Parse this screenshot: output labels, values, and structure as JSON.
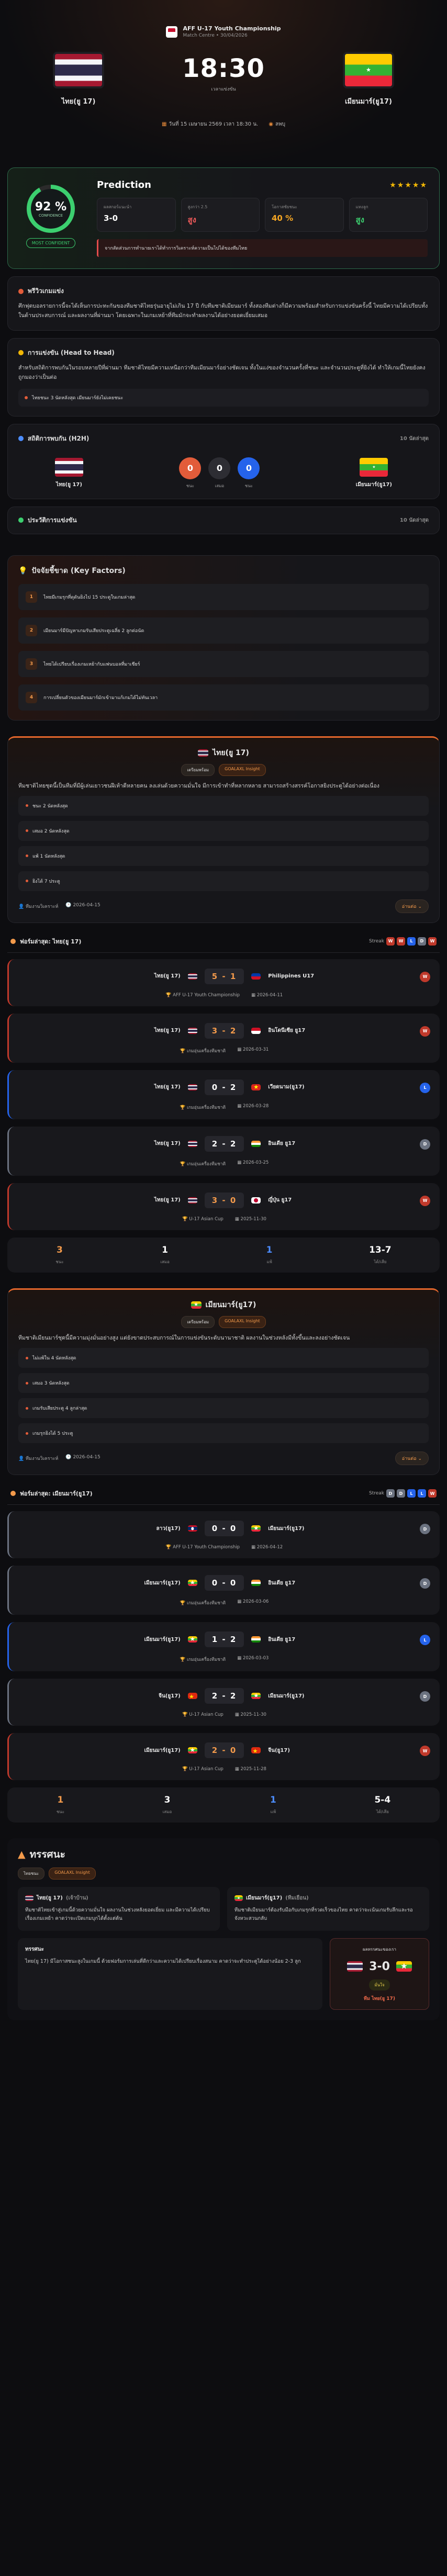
{
  "match": {
    "tournament": "AFF U-17 Youth Championship",
    "stage": "Match Centre • 30/04/2026",
    "home": "ไทย(ยู 17)",
    "away": "เมียนมาร์(ยู17)",
    "time": "18:30",
    "status": "เวลาแข่งขัน",
    "date": "วันที่ 15 เมษายน 2569 เวลา 18:30 น.",
    "venue": "ลพบุ"
  },
  "prediction": {
    "title": "Prediction",
    "confidence": "92 %",
    "confidence_label": "CONFIDENCE",
    "badge": "MOST CONFIDENT",
    "stats": [
      {
        "k": "ผลสกอร์แนะนำ",
        "v": "3-0",
        "c": ""
      },
      {
        "k": "สูงกว่า 2.5",
        "v": "สูง",
        "c": "red"
      },
      {
        "k": "โอกาสชัยชนะ",
        "v": "40 %",
        "c": "org"
      },
      {
        "k": "แทงลูก",
        "v": "สูง",
        "c": "grn"
      }
    ],
    "note": "จากสัดส่วนการทำนายเราได้ทำการวิเคราะห์ความเป็นไปได้ของทีมไทย"
  },
  "preview": {
    "title": "พรีวิวเกมแข่ง",
    "text": "ศึกฟุตบอลรายการนี้จะได้เห็นการปะทะกันของทีมชาติไทยรุ่นอายุไม่เกิน 17 ปี กับทีมชาติเมียนมาร์ ทั้งสองทีมต่างก็มีความพร้อมสำหรับการแข่งขันครั้งนี้ ไทยมีความได้เปรียบทั้งในด้านประสบการณ์ และผลงานที่ผ่านมา โดยเฉพาะในเกมเหย้าที่ทีมมักจะทำผลงานได้อย่างยอดเยี่ยมเสมอ"
  },
  "h2h": {
    "title": "การแข่งขัน (Head to Head)",
    "text": "สำหรับสถิติการพบกันในรอบหลายปีที่ผ่านมา ทีมชาติไทยมีความเหนือกว่าทีมเมียนมาร์อย่างชัดเจน ทั้งในแง่ของจำนวนครั้งที่ชนะ และจำนวนประตูที่ยิงได้ ทำให้เกมนี้ไทยยังคงถูกมองว่าเป็นต่อ",
    "pill": "ไทยชนะ 3 นัดหลังสุด เมียนมาร์ยังไม่เคยชนะ"
  },
  "h2h_stats": {
    "title": "สถิติการพบกัน (H2H)",
    "right": "10 นัดล่าสุด",
    "home_win": "0",
    "draw": "0",
    "away_win": "0",
    "home_label": "ชนะ",
    "draw_label": "เสมอ",
    "away_label": "ชนะ"
  },
  "form_title": {
    "title": "ประวัติการแข่งขัน",
    "right": "10 นัดล่าสุด"
  },
  "key_factors": {
    "title": "ปัจจัยชี้ขาด (Key Factors)",
    "items": [
      "ไทยมีเกมรุกที่ดุดันยิงไป 15 ประตูในเกมล่าสุด",
      "เมียนมาร์มีปัญหาเกมรับเสียประตูเฉลี่ย 2 ลูกต่อนัด",
      "ไทยได้เปรียบเรื่องเกมเหย้ากับแฟนบอลที่มาเชียร์",
      "การเปลี่ยนตัวของเมียนมาร์มักเข้ามาแก้เกมได้ไม่ทันเวลา"
    ]
  },
  "insight_home": {
    "team": "ไทย(ยู 17)",
    "tag1": "เตรียมพร้อม",
    "tag2": "GOALAXL Insight",
    "text": "ทีมชาติไทยชุดนี้เป็นทีมที่มีผู้เล่นเยาวชนฝีเท้าดีหลายคน ลงเล่นด้วยความมั่นใจ มีการเข้าทำที่หลากหลาย สามารถสร้างสรรค์โอกาสยิงประตูได้อย่างต่อเนื่อง",
    "bullets": [
      "ชนะ 2 นัดหลังสุด",
      "เสมอ 2 นัดหลังสุด",
      "แพ้ 1 นัดหลังสุด",
      "ยิงได้ 7 ประตู"
    ],
    "author": "ทีมงานวิเคราะห์",
    "date": "2026-04-15",
    "more": "อ่านต่อ"
  },
  "form_home": {
    "title": "ฟอร์มล่าสุด: ไทย(ยู 17)",
    "streak_label": "Streak",
    "streak": [
      "W",
      "W",
      "L",
      "D",
      "W"
    ],
    "matches": [
      {
        "home": "ไทย(ยู 17)",
        "away": "Philippines U17",
        "score": "5 - 1",
        "res": "W",
        "comp": "AFF U-17 Youth Championship",
        "date": "2026-04-11",
        "hf": "flag-th",
        "af": "flag-ph"
      },
      {
        "home": "ไทย(ยู 17)",
        "away": "อินโดนีเซีย ยู17",
        "score": "3 - 2",
        "res": "W",
        "comp": "เกมอุ่นเครื่องทีมชาติ",
        "date": "2026-03-31",
        "hf": "flag-th",
        "af": "flag-id"
      },
      {
        "home": "ไทย(ยู 17)",
        "away": "เวียดนาม(ยู17)",
        "score": "0 - 2",
        "res": "L",
        "comp": "เกมอุ่นเครื่องทีมชาติ",
        "date": "2026-03-28",
        "hf": "flag-th",
        "af": "flag-vn"
      },
      {
        "home": "ไทย(ยู 17)",
        "away": "อินเดีย ยู17",
        "score": "2 - 2",
        "res": "D",
        "comp": "เกมอุ่นเครื่องทีมชาติ",
        "date": "2026-03-25",
        "hf": "flag-th",
        "af": "flag-in"
      },
      {
        "home": "ไทย(ยู 17)",
        "away": "ญี่ปุ่น ยู17",
        "score": "3 - 0",
        "res": "W",
        "comp": "U-17 Asian Cup",
        "date": "2025-11-30",
        "hf": "flag-th",
        "af": "flag-jp"
      }
    ],
    "summary": [
      {
        "v": "3",
        "k": "ชนะ",
        "c": "#f39a4b"
      },
      {
        "v": "1",
        "k": "เสมอ",
        "c": "#ffffff"
      },
      {
        "v": "1",
        "k": "แพ้",
        "c": "#4c8dff"
      },
      {
        "v": "13-7",
        "k": "ได้/เสีย",
        "c": "#ffffff"
      }
    ]
  },
  "insight_away": {
    "team": "เมียนมาร์(ยู17)",
    "tag1": "เตรียมพร้อม",
    "tag2": "GOALAXL Insight",
    "text": "ทีมชาติเมียนมาร์ชุดนี้มีความมุ่งมั่นอย่างสูง แต่ยังขาดประสบการณ์ในการแข่งขันระดับนานาชาติ ผลงานในช่วงหลังมีทั้งขึ้นและลงอย่างชัดเจน",
    "bullets": [
      "ไม่แพ้ใน 4 นัดหลังสุด",
      "เสมอ 3 นัดหลังสุด",
      "เกมรับเสียประตู 4 ลูกล่าสุด",
      "เกมรุกยิงได้ 5 ประตู"
    ],
    "author": "ทีมงานวิเคราะห์",
    "date": "2026-04-15",
    "more": "อ่านต่อ"
  },
  "form_away": {
    "title": "ฟอร์มล่าสุด: เมียนมาร์(ยู17)",
    "streak_label": "Streak",
    "streak": [
      "D",
      "D",
      "L",
      "L",
      "W"
    ],
    "matches": [
      {
        "home": "ลาว(ยู17)",
        "away": "เมียนมาร์(ยู17)",
        "score": "0 - 0",
        "res": "D",
        "comp": "AFF U-17 Youth Championship",
        "date": "2026-04-12",
        "hf": "flag-la",
        "af": "flag-mm"
      },
      {
        "home": "เมียนมาร์(ยู17)",
        "away": "อินเดีย ยู17",
        "score": "0 - 0",
        "res": "D",
        "comp": "เกมอุ่นเครื่องทีมชาติ",
        "date": "2026-03-06",
        "hf": "flag-mm",
        "af": "flag-in"
      },
      {
        "home": "เมียนมาร์(ยู17)",
        "away": "อินเดีย ยู17",
        "score": "1 - 2",
        "res": "L",
        "comp": "เกมอุ่นเครื่องทีมชาติ",
        "date": "2026-03-03",
        "hf": "flag-mm",
        "af": "flag-in"
      },
      {
        "home": "จีน(ยู17)",
        "away": "เมียนมาร์(ยู17)",
        "score": "2 - 2",
        "res": "D",
        "comp": "U-17 Asian Cup",
        "date": "2025-11-30",
        "hf": "flag-cn",
        "af": "flag-mm"
      },
      {
        "home": "เมียนมาร์(ยู17)",
        "away": "จีน(ยู17)",
        "score": "2 - 0",
        "res": "W",
        "comp": "U-17 Asian Cup",
        "date": "2025-11-28",
        "hf": "flag-mm",
        "af": "flag-cn"
      }
    ],
    "summary": [
      {
        "v": "1",
        "k": "ชนะ",
        "c": "#f39a4b"
      },
      {
        "v": "3",
        "k": "เสมอ",
        "c": "#ffffff"
      },
      {
        "v": "1",
        "k": "แพ้",
        "c": "#4c8dff"
      },
      {
        "v": "5-4",
        "k": "ได้/เสีย",
        "c": "#ffffff"
      }
    ]
  },
  "analysis": {
    "title": "ทรรศนะ",
    "tag1": "ไทยชนะ",
    "tag2": "GOALAXL Insight",
    "home_title": "ไทย(ยู 17)",
    "home_sub": "(เจ้าบ้าน)",
    "home_text": "ทีมชาติไทยเข้าสู่เกมนี้ด้วยความมั่นใจ ผลงานในช่วงหลังยอดเยี่ยม และมีความได้เปรียบเรื่องเกมเหย้า คาดว่าจะเปิดเกมบุกได้ตั้งแต่ต้น",
    "away_title": "เมียนมาร์(ยู17)",
    "away_sub": "(ทีมเยือน)",
    "away_text": "ทีมชาติเมียนมาร์ต้องรับมือกับเกมรุกที่รวดเร็วของไทย คาดว่าจะเน้นเกมรับลึกและรอจังหวะสวนกลับ",
    "final_title": "ทรรศนะ",
    "final_text": "ไทย(ยู 17) มีโอกาสชนะสูงในเกมนี้ ด้วยฟอร์มการเล่นที่ดีกว่าและความได้เปรียบเรื่องสนาม คาดว่าจะทำประตูได้อย่างน้อย 2-3 ลูก",
    "box_label": "ผลทรรศนะของเรา",
    "box_score": "3-0",
    "box_pill": "มั่นใจ",
    "box_win": "ทีม ไทย(ยู 17)"
  }
}
